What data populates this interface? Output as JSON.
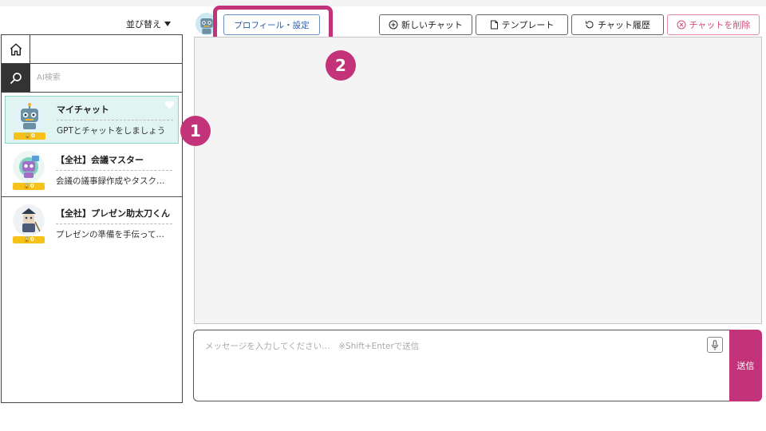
{
  "header": {
    "sort_label": "並び替え",
    "profile_button": "プロフィール・設定",
    "new_chat": "新しいチャット",
    "template": "テンプレート",
    "history": "チャット履歴",
    "delete_chat": "チャットを削除"
  },
  "sidebar": {
    "search_placeholder": "AI検索",
    "items": [
      {
        "name": "マイチャット",
        "desc": "GPTとチャットをしましょう",
        "badge": "0",
        "active": true
      },
      {
        "name": "【全社】会議マスター",
        "desc": "会議の議事録作成やタスク…",
        "badge": "0",
        "active": false
      },
      {
        "name": "【全社】プレゼン助太刀くん",
        "desc": "プレゼンの準備を手伝って…",
        "badge": "0",
        "active": false
      }
    ]
  },
  "composer": {
    "placeholder": "メッセージを入力してください…　※Shift+Enterで送信",
    "send_label": "送信"
  },
  "annotations": {
    "marker_1": "1",
    "marker_2": "2"
  },
  "colors": {
    "accent": "#c2337a",
    "active_item_bg": "#e0f4f1",
    "badge": "#f6c21a",
    "profile_button_text": "#2c5aa0"
  }
}
